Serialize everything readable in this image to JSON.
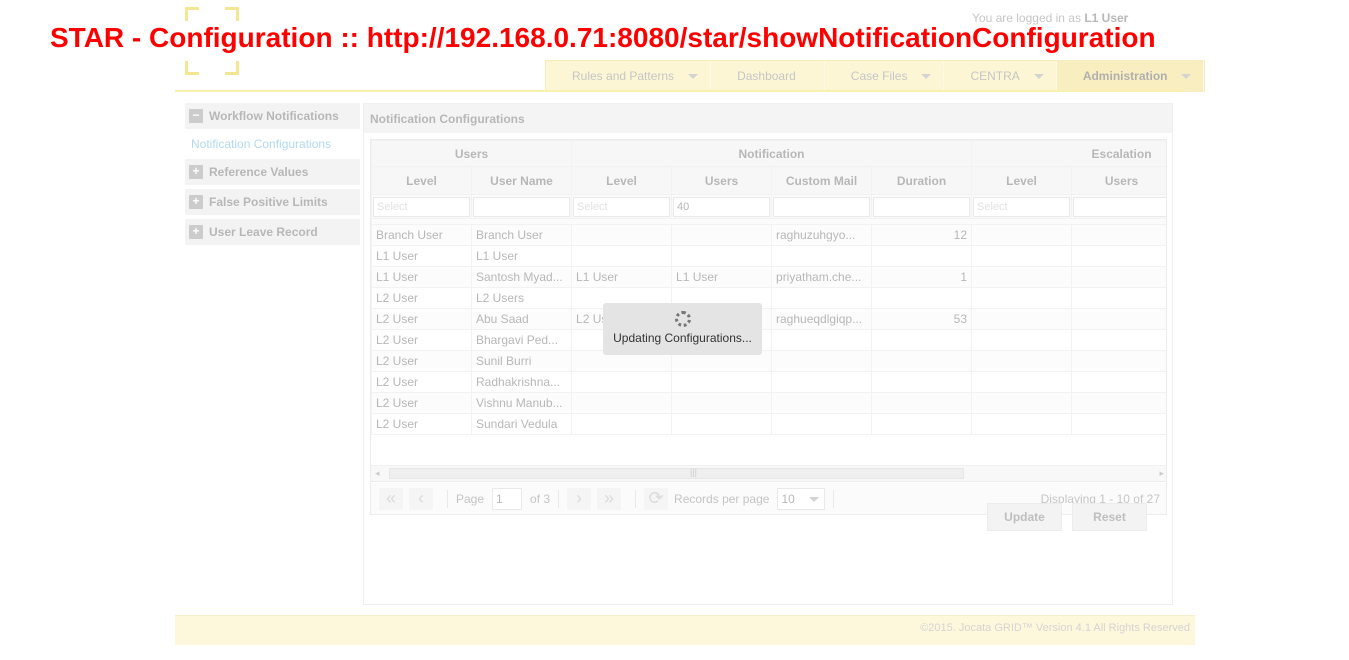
{
  "page_title": "STAR - Configuration :: http://192.168.0.71:8080/star/showNotificationConfiguration",
  "header": {
    "logged_in_prefix": "You are logged in as ",
    "logged_in_user": "L1 User"
  },
  "nav": [
    {
      "label": "Rules and Patterns",
      "dropdown": true
    },
    {
      "label": "Dashboard",
      "dropdown": false
    },
    {
      "label": "Case Files",
      "dropdown": true
    },
    {
      "label": "CENTRA",
      "dropdown": true
    },
    {
      "label": "Administration",
      "dropdown": true,
      "active": true
    }
  ],
  "sidebar": {
    "workflow": "Workflow Notifications",
    "workflow_link": "Notification Configurations",
    "reference": "Reference Values",
    "false_positive": "False Positive Limits",
    "leave": "User Leave Record"
  },
  "panel": {
    "title": "Notification Configurations",
    "groups": [
      "Users",
      "Notification",
      "Escalation"
    ],
    "columns": [
      "Level",
      "User Name",
      "Level",
      "Users",
      "Custom Mail",
      "Duration",
      "Level",
      "Users"
    ],
    "filters": [
      "Select",
      "",
      "Select",
      "40",
      "",
      "",
      "Select",
      ""
    ],
    "rows": [
      [
        "Branch User",
        "Branch User",
        "",
        "",
        "raghuzuhgyo...",
        "12",
        "",
        ""
      ],
      [
        "L1 User",
        "L1 User",
        "",
        "",
        "",
        "",
        "",
        ""
      ],
      [
        "L1 User",
        "Santosh Myad...",
        "L1 User",
        "L1 User",
        "priyatham.che...",
        "1",
        "",
        ""
      ],
      [
        "L2 User",
        "L2 Users",
        "",
        "",
        "",
        "",
        "",
        ""
      ],
      [
        "L2 User",
        "Abu Saad",
        "L2 Us",
        "",
        "raghueqdlgiqp...",
        "53",
        "",
        ""
      ],
      [
        "L2 User",
        "Bhargavi Ped...",
        "",
        "",
        "",
        "",
        "",
        ""
      ],
      [
        "L2 User",
        "Sunil Burri",
        "",
        "",
        "",
        "",
        "",
        ""
      ],
      [
        "L2 User",
        "Radhakrishna...",
        "",
        "",
        "",
        "",
        "",
        ""
      ],
      [
        "L2 User",
        "Vishnu Manub...",
        "",
        "",
        "",
        "",
        "",
        ""
      ],
      [
        "L2 User",
        "Sundari Vedula",
        "",
        "",
        "",
        "",
        "",
        ""
      ]
    ]
  },
  "pager": {
    "page_label": "Page",
    "page": "1",
    "of_label": "of 3",
    "records_label": "Records per page",
    "records": "10",
    "info": "Displaying 1 - 10 of 27"
  },
  "buttons": {
    "update": "Update",
    "reset": "Reset"
  },
  "loading": "Updating Configurations...",
  "footer": "©2015. Jocata GRID™ Version 4.1 All Rights Reserved",
  "colors": {
    "title_red": "#ff0000",
    "nav_yellow": "#f8ec9c",
    "link_blue": "#4aa3df"
  }
}
